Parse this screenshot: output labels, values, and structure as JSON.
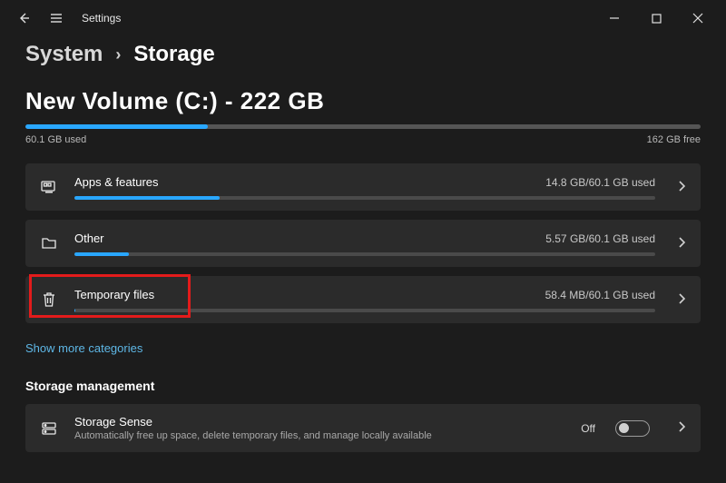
{
  "window": {
    "title": "Settings"
  },
  "breadcrumb": {
    "parent": "System",
    "current": "Storage"
  },
  "volume": {
    "title": "New Volume (C:) - 222 GB",
    "used_label": "60.1 GB used",
    "free_label": "162 GB free",
    "used_gb": 60.1,
    "total_gb": 222,
    "fill_percent": 27
  },
  "categories": [
    {
      "name": "Apps & features",
      "used_label": "14.8 GB/60.1 GB used",
      "fill_percent": 25,
      "icon": "apps-icon"
    },
    {
      "name": "Other",
      "used_label": "5.57 GB/60.1 GB used",
      "fill_percent": 9.3,
      "icon": "folder-icon"
    },
    {
      "name": "Temporary files",
      "used_label": "58.4 MB/60.1 GB used",
      "fill_percent": 0.1,
      "icon": "trash-icon",
      "highlighted": true
    }
  ],
  "show_more_label": "Show more categories",
  "management_heading": "Storage management",
  "storage_sense": {
    "title": "Storage Sense",
    "description": "Automatically free up space, delete temporary files, and manage locally available",
    "toggle_label": "Off",
    "toggle_on": false
  },
  "colors": {
    "accent": "#29a7ff",
    "highlight": "#e31b1b",
    "bg": "#1c1c1c",
    "row_bg": "#2b2b2b"
  }
}
